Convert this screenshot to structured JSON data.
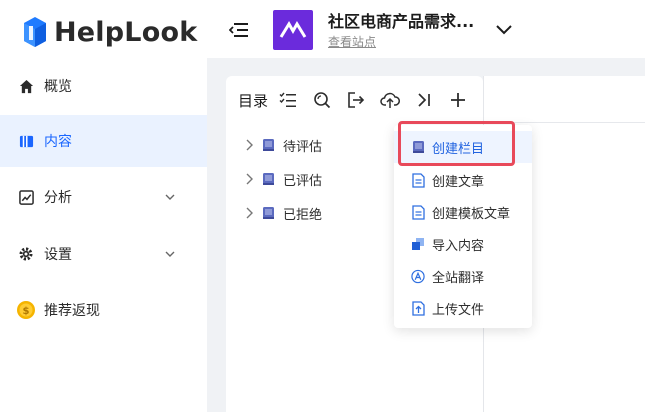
{
  "brand": {
    "name": "HelpLook",
    "logo_color": "#1f7bff"
  },
  "sidebar": {
    "items": [
      {
        "label": "概览",
        "icon": "home-icon",
        "active": false,
        "has_chevron": false
      },
      {
        "label": "内容",
        "icon": "book-open-icon",
        "active": true,
        "has_chevron": false
      },
      {
        "label": "分析",
        "icon": "chart-line-icon",
        "active": false,
        "has_chevron": true
      },
      {
        "label": "设置",
        "icon": "gear-icon",
        "active": false,
        "has_chevron": true
      },
      {
        "label": "推荐返现",
        "icon": "coin-icon",
        "active": false,
        "has_chevron": false
      }
    ]
  },
  "header": {
    "site_name": "社区电商产品需求...",
    "site_link": "查看站点",
    "site_logo_color": "#6b2bdc"
  },
  "catalog": {
    "title": "目录",
    "toolbar_icons": [
      "checklist-icon",
      "search-icon",
      "export-icon",
      "upload-cloud-icon",
      "collapse-right-icon",
      "plus-icon"
    ],
    "items": [
      {
        "label": "待评估"
      },
      {
        "label": "已评估"
      },
      {
        "label": "已拒绝"
      }
    ]
  },
  "dropdown": {
    "items": [
      {
        "label": "创建栏目",
        "icon": "book-icon",
        "highlighted": true
      },
      {
        "label": "创建文章",
        "icon": "document-icon",
        "highlighted": false
      },
      {
        "label": "创建模板文章",
        "icon": "document-icon",
        "highlighted": false
      },
      {
        "label": "导入内容",
        "icon": "import-icon",
        "highlighted": false
      },
      {
        "label": "全站翻译",
        "icon": "translate-icon",
        "highlighted": false
      },
      {
        "label": "上传文件",
        "icon": "upload-file-icon",
        "highlighted": false
      }
    ]
  },
  "colors": {
    "accent": "#1a66ff",
    "highlight_border": "#e8495a",
    "active_bg": "#eaf2ff"
  }
}
